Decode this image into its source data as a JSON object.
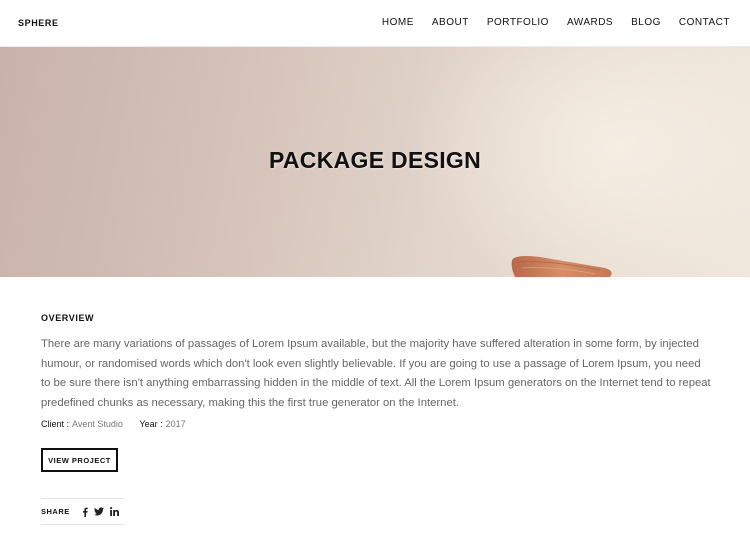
{
  "header": {
    "brand": "SPHERE",
    "nav": [
      {
        "label": "HOME"
      },
      {
        "label": "ABOUT"
      },
      {
        "label": "PORTFOLIO"
      },
      {
        "label": "AWARDS"
      },
      {
        "label": "BLOG"
      },
      {
        "label": "CONTACT"
      }
    ]
  },
  "hero": {
    "title": "PACKAGE DESIGN"
  },
  "overview": {
    "heading": "OVERVIEW",
    "text": "There are many variations of passages of Lorem Ipsum available, but the majority have suffered alteration in some form, by injected humour, or randomised words which don't look even slightly believable. If you are going to use a passage of Lorem Ipsum, you need to be sure there isn't anything embarrassing hidden in the middle of text. All the Lorem Ipsum generators on the Internet tend to repeat predefined chunks as necessary, making this the first true generator on the Internet."
  },
  "meta": {
    "client_label": "Client :",
    "client_value": "Avent Studio",
    "year_label": "Year :",
    "year_value": "2017"
  },
  "actions": {
    "view_project": "VIEW PROJECT"
  },
  "share": {
    "label": "SHARE",
    "icons": [
      "facebook-icon",
      "twitter-icon",
      "linkedin-icon"
    ]
  },
  "colors": {
    "text": "#111111",
    "muted": "#666666",
    "hero_left": "#c9b2aa",
    "hero_right": "#efe6dc"
  }
}
